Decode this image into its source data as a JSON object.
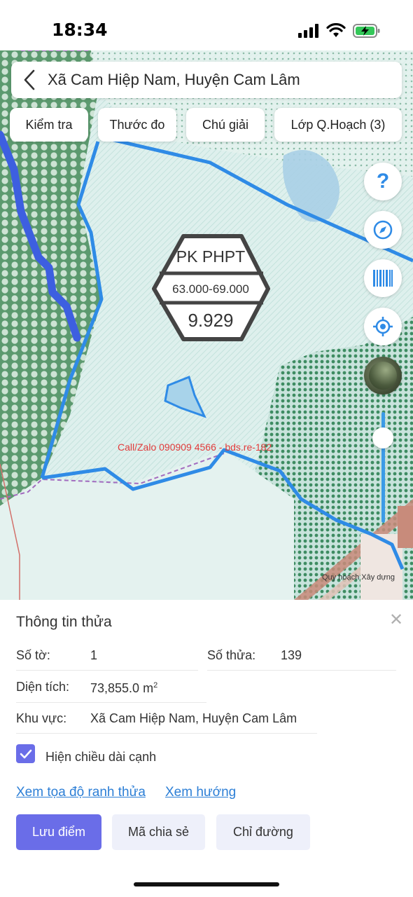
{
  "status": {
    "time": "18:34"
  },
  "map": {
    "header_title": "Xã Cam Hiệp Nam, Huyện Cam Lâm",
    "tools": [
      "Kiểm tra",
      "Thước đo",
      "Chú giải",
      "Lớp Q.Hoạch (3)"
    ],
    "zone_code": "PK PHPT",
    "zone_range": "63.000-69.000",
    "zone_value": "9.929",
    "watermark": "Call/Zalo 090909 4566 - bds.re-182",
    "small_label": "Quy hoạch Xây dựng",
    "buttons": [
      "help-icon",
      "compass-icon",
      "barcode-icon",
      "locate-icon",
      "satellite-layer-icon"
    ]
  },
  "panel": {
    "title": "Thông tin thửa",
    "so_to_label": "Số tờ:",
    "so_to_value": "1",
    "so_thua_label": "Số thửa:",
    "so_thua_value": "139",
    "dien_tich_label": "Diện tích:",
    "dien_tich_value": "73,855.0 m",
    "dien_tich_unit_sup": "2",
    "khu_vuc_label": "Khu vực:",
    "khu_vuc_value": "Xã Cam Hiệp Nam, Huyện Cam Lâm",
    "checkbox_label": "Hiện chiều dài cạnh",
    "checkbox_checked": true,
    "link_coords": "Xem tọa độ ranh thửa",
    "link_direction": "Xem hướng",
    "btn_save": "Lưu điểm",
    "btn_share": "Mã chia sẻ",
    "btn_route": "Chỉ đường"
  },
  "colors": {
    "accent": "#6a6de8",
    "link": "#2d7fd6",
    "boundary": "#2f8be6"
  }
}
